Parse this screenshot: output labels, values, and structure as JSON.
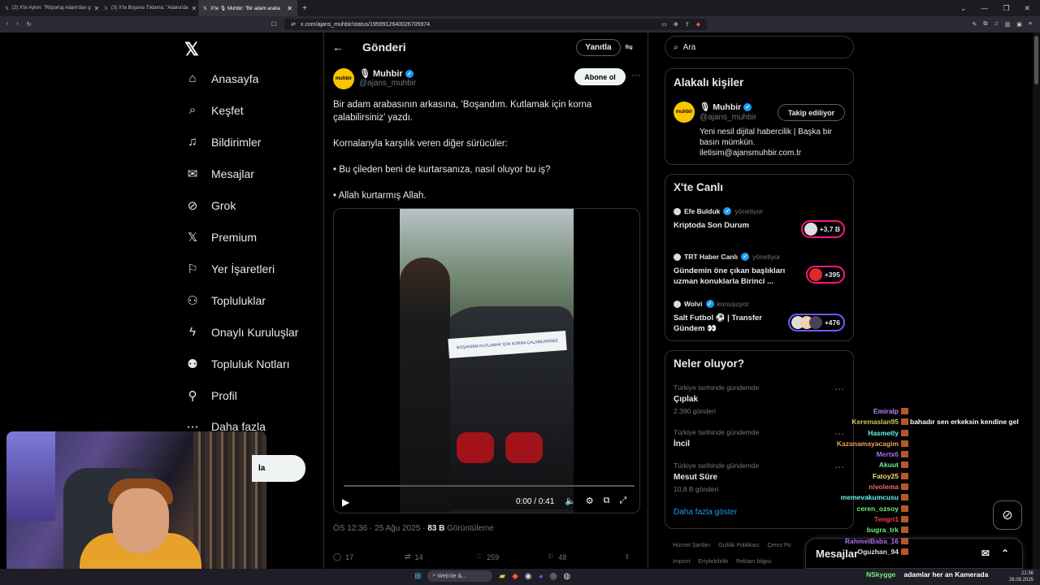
{
  "browser": {
    "tabs": [
      {
        "label": "(2) X'te Aylon: \"Röportaj Adam'dan g"
      },
      {
        "label": "(3) X'te Boşuna Tıklama: \"Adana'da"
      },
      {
        "label": "X'te 🎙 Muhbir: \"Bir adam araba"
      }
    ],
    "url": "x.com/ajans_muhbir/status/1959912640026705974"
  },
  "nav": {
    "items": [
      "Anasayfa",
      "Keşfet",
      "Bildirimler",
      "Mesajlar",
      "Grok",
      "Premium",
      "Yer İşaretleri",
      "Topluluklar",
      "Onaylı Kuruluşlar",
      "Topluluk Notları",
      "Profil",
      "Daha fazla"
    ],
    "post_button_partial": "la"
  },
  "header": {
    "title": "Gönderi",
    "reply_button": "Yanıtla"
  },
  "tweet": {
    "avatar_text": "muhbir",
    "name": "🎙 Muhbir",
    "handle": "@ajans_muhbir",
    "subscribe_button": "Abone ol",
    "paragraphs": [
      "Bir adam arabasının arkasına, ‘Boşandım. Kutlamak için korna çalabilirsiniz’ yazdı.",
      "Kornalanyla karşılık veren diğer sürücüler:",
      "• Bu çileden beni de kurtarsanıza, nasıl oluyor bu iş?",
      "• Allah kurtarmış Allah."
    ],
    "video": {
      "time": "0:00 / 0:41",
      "sign_text": "BOŞANDIM KUTLAMAK İÇİN KORNA ÇALABİLİRSİNİZ",
      "progress": 0
    },
    "timestamp": "ÖS 12:36 · 25 Ağu 2025 ·",
    "views_count": "83 B",
    "views_label": "Görüntüleme",
    "stats": {
      "replies": "17",
      "reposts": "14",
      "likes": "259",
      "bookmarks": "48"
    }
  },
  "search": {
    "placeholder": "Ara"
  },
  "related": {
    "title": "Alakalı kişiler",
    "name": "🎙 Muhbir",
    "handle": "@ajans_muhbir",
    "follow_button": "Takip ediliyor",
    "bio": "Yeni nesil dijital habercilik | Başka bir basın mümkün. iletisim@ajansmuhbir.com.tr"
  },
  "live": {
    "title": "X'te Canlı",
    "items": [
      {
        "host": "Efe Bulduk",
        "status": "yönetiyor",
        "topic": "Kriptoda Son Durum",
        "count": "+3,7 B"
      },
      {
        "host": "TRT Haber Canlı",
        "status": "yönetiyor",
        "topic": "Gündemin öne çıkan başlıkları uzman konuklarla Birinci ...",
        "count": "+395"
      },
      {
        "host": "Wolvi",
        "status": "konuşuyor",
        "topic": "Salt Futbol ⚽ | Transfer Gündem 👀",
        "count": "+476"
      }
    ]
  },
  "trends": {
    "title": "Neler oluyor?",
    "items": [
      {
        "context": "Türkiye tarihinde gündemde",
        "name": "Çıplak",
        "count": "2.390 gönderi"
      },
      {
        "context": "Türkiye tarihinde gündemde",
        "name": "İncil",
        "count": ""
      },
      {
        "context": "Türkiye tarihinde gündemde",
        "name": "Mesut Süre",
        "count": "10,8 B gönderi"
      }
    ],
    "show_more": "Daha fazla göster"
  },
  "footer": {
    "links": [
      "Hizmet Şartları",
      "Gizlilik Politikası",
      "Çerez Po",
      "Imprint",
      "Erişilebilirlik",
      "Reklam bilgisi"
    ]
  },
  "messages_drawer": {
    "title": "Mesajlar"
  },
  "chat": {
    "lines": [
      {
        "user": "Emiralp",
        "color": "#b388ff",
        "msg": ""
      },
      {
        "user": "Keremaslan95",
        "color": "#d4c84a",
        "msg": "bahadır sen erkeksin kendine gel"
      },
      {
        "user": "Hasmetly",
        "color": "#6cf0f0",
        "msg": ""
      },
      {
        "user": "Kazanamayacagim",
        "color": "#f0a050",
        "msg": ""
      },
      {
        "user": "Mertx6",
        "color": "#b06cf0",
        "msg": ""
      },
      {
        "user": "Akuut",
        "color": "#6cf0a0",
        "msg": ""
      },
      {
        "user": "Fatoy25",
        "color": "#f0e06c",
        "msg": ""
      },
      {
        "user": "nivolema",
        "color": "#f06c6c",
        "msg": ""
      },
      {
        "user": "memevakumcusu",
        "color": "#6cf0f0",
        "msg": ""
      },
      {
        "user": "ceren_ozsoy",
        "color": "#6cf07a",
        "msg": ""
      },
      {
        "user": "Tengri1",
        "color": "#f04040",
        "msg": ""
      },
      {
        "user": "bugra_trk",
        "color": "#6cf07a",
        "msg": ""
      },
      {
        "user": "RahmetBaba_16",
        "color": "#b06cf0",
        "msg": ""
      },
      {
        "user": "Oguzhan_94",
        "color": "#e0e0e0",
        "msg": ""
      }
    ],
    "last_user": "NSkygge",
    "last_msg": "adamlar her an Kamerada"
  },
  "taskbar": {
    "search_label": "Web'de &...",
    "time": "21:36",
    "date": "26.08.2025"
  },
  "colors": {
    "accent": "#1d9bf0",
    "live_pink": "#f91880",
    "bg": "#000000"
  }
}
